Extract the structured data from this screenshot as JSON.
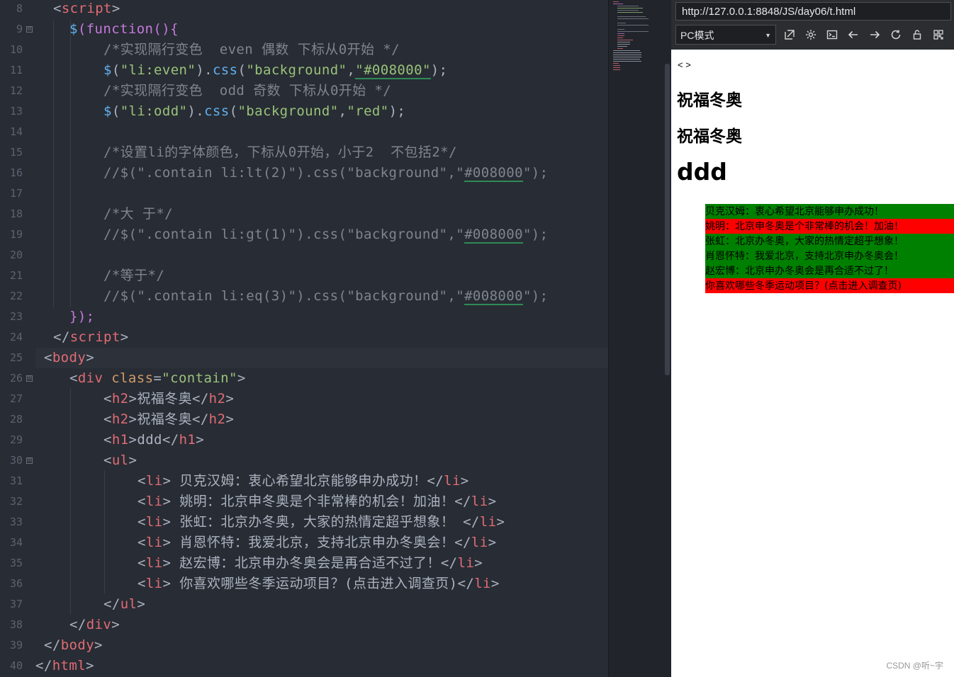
{
  "editor": {
    "line_numbers": [
      "8",
      "9",
      "10",
      "11",
      "12",
      "13",
      "14",
      "15",
      "16",
      "17",
      "18",
      "19",
      "20",
      "21",
      "22",
      "23",
      "24",
      "25",
      "26",
      "27",
      "28",
      "29",
      "30",
      "31",
      "32",
      "33",
      "34",
      "35",
      "36",
      "37",
      "38",
      "39",
      "40"
    ],
    "fold_marker": "⊟",
    "lines": {
      "l8_open": "<",
      "l8_tag": "script",
      "l8_close": ">",
      "l9_dollar": "$",
      "l9_paren": "(",
      "l9_function": "function",
      "l9_rest": "(){",
      "l10_comment": "/*实现隔行变色  even 偶数 下标从0开始 */",
      "l11_dollar": "$",
      "l11_p1": "(",
      "l11_sel": "\"li:even\"",
      "l11_p2": ").",
      "l11_css": "css",
      "l11_p3": "(",
      "l11_prop": "\"background\"",
      "l11_comma": ",",
      "l11_val": "\"#008000\"",
      "l11_end": ");",
      "l12_comment": "/*实现隔行变色  odd 奇数 下标从0开始 */",
      "l13_dollar": "$",
      "l13_p1": "(",
      "l13_sel": "\"li:odd\"",
      "l13_p2": ").",
      "l13_css": "css",
      "l13_p3": "(",
      "l13_prop": "\"background\"",
      "l13_comma": ",",
      "l13_val": "\"red\"",
      "l13_end": ");",
      "l15_comment": "/*设置li的字体颜色，下标从0开始，小于2  不包括2*/",
      "l16_a": "//$(\".contain li:lt(2)\").css(\"background\",\"",
      "l16_u": "#008000",
      "l16_b": "\");",
      "l18_comment": "/*大 于*/",
      "l19_a": "//$(\".contain li:gt(1)\").css(\"background\",\"",
      "l19_u": "#008000",
      "l19_b": "\");",
      "l21_comment": "/*等于*/",
      "l22_a": "//$(\".contain li:eq(3)\").css(\"background\",\"",
      "l22_u": "#008000",
      "l22_b": "\");",
      "l23": "});",
      "l24_open": "</",
      "l24_tag": "script",
      "l24_close": ">",
      "l25_open": "<",
      "l25_tag": "body",
      "l25_close": ">",
      "l26_open": "<",
      "l26_tag": "div",
      "l26_attr": " class",
      "l26_eq": "=",
      "l26_val": "\"contain\"",
      "l26_close": ">",
      "l27_o": "<",
      "l27_t": "h2",
      "l27_c": ">",
      "l27_text": "祝福冬奥",
      "l27_eo": "</",
      "l27_et": "h2",
      "l27_ec": ">",
      "l28_o": "<",
      "l28_t": "h2",
      "l28_c": ">",
      "l28_text": "祝福冬奥",
      "l28_eo": "</",
      "l28_et": "h2",
      "l28_ec": ">",
      "l29_o": "<",
      "l29_t": "h1",
      "l29_c": ">",
      "l29_text": "ddd",
      "l29_eo": "</",
      "l29_et": "h1",
      "l29_ec": ">",
      "l30_o": "<",
      "l30_t": "ul",
      "l30_c": ">",
      "li_tag": "li",
      "li_open": "<",
      "li_close": ">",
      "li_end_open": "</",
      "l31_text": " 贝克汉姆：衷心希望北京能够申办成功！",
      "l32_text": " 姚明：北京申冬奥是个非常棒的机会！加油！",
      "l33_text": " 张虹：北京办冬奥，大家的热情定超乎想象！ ",
      "l34_text": " 肖恩怀特：我爱北京，支持北京申办冬奥会！",
      "l35_text": " 赵宏博：北京申办冬奥会是再合适不过了！",
      "l36_text": " 你喜欢哪些冬季运动项目？(点击进入调查页)",
      "l37_o": "</",
      "l37_t": "ul",
      "l37_c": ">",
      "l38_o": "</",
      "l38_t": "div",
      "l38_c": ">",
      "l39_o": "</",
      "l39_t": "body",
      "l39_c": ">",
      "l40_o": "</",
      "l40_t": "html",
      "l40_c": ">"
    }
  },
  "browser": {
    "url": "http://127.0.0.1:8848/JS/day06/t.html",
    "mode_label": "PC模式",
    "toolbar_icons": [
      "external-window-icon",
      "settings-gear-icon",
      "console-icon",
      "back-arrow-icon",
      "forward-arrow-icon",
      "reload-icon",
      "lock-icon",
      "qr-code-icon"
    ],
    "page": {
      "tiny_text": "< >",
      "h2_1": "祝福冬奥",
      "h2_2": "祝福冬奥",
      "h1": "ddd",
      "items": [
        {
          "text": "贝克汉姆：衷心希望北京能够申办成功！",
          "bg": "#008000"
        },
        {
          "text": "姚明：北京申冬奥是个非常棒的机会！加油！",
          "bg": "#ff0000"
        },
        {
          "text": "张虹：北京办冬奥，大家的热情定超乎想象！",
          "bg": "#008000"
        },
        {
          "text": "肖恩怀特：我爱北京，支持北京申办冬奥会！",
          "bg": "#008000"
        },
        {
          "text": "赵宏博：北京申办冬奥会是再合适不过了！",
          "bg": "#008000"
        },
        {
          "text": "你喜欢哪些冬季运动项目？(点击进入调查页)",
          "bg": "#ff0000"
        }
      ]
    },
    "watermark": "CSDN @听~宇"
  },
  "colors": {
    "editor_bg": "#282c34",
    "tag": "#e06c75",
    "string": "#98c379",
    "function": "#61afef",
    "keyword": "#c678dd",
    "comment": "#7f848e",
    "even_green": "#008000",
    "odd_red": "#ff0000"
  }
}
